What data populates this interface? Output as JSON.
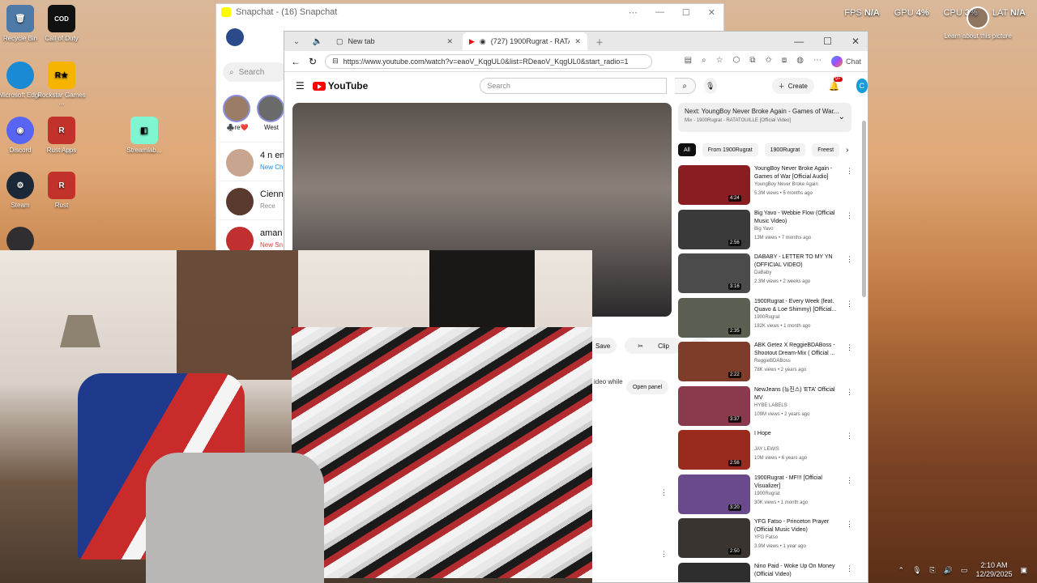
{
  "desktop": {
    "icons": [
      {
        "label": "Recycle Bin",
        "icon": "recycle-bin-icon",
        "color": "#4e7aa8"
      },
      {
        "label": "Call of Duty",
        "icon": "call-of-duty-icon",
        "color": "#111111"
      },
      {
        "label": "Microsoft Edge",
        "icon": "edge-icon",
        "color": "#1a8ad4"
      },
      {
        "label": "Rockstar Games ...",
        "icon": "rockstar-icon",
        "color": "#f4b400"
      },
      {
        "label": "Discord",
        "icon": "discord-icon",
        "color": "#5865f2"
      },
      {
        "label": "Rust Apps",
        "icon": "rust-icon",
        "color": "#c2322a"
      },
      {
        "label": "Streamlab...",
        "icon": "streamlabs-icon",
        "color": "#80f5d2"
      },
      {
        "label": "Steam",
        "icon": "steam-icon",
        "color": "#1b2838"
      },
      {
        "label": "Rust",
        "icon": "rust-icon",
        "color": "#c2322a"
      },
      {
        "label": "OBS",
        "icon": "obs-icon",
        "color": "#302e31"
      }
    ]
  },
  "overlay": {
    "fps_label": "FPS",
    "fps_value": "N/A",
    "gpu_label": "GPU",
    "gpu_value": "4%",
    "cpu_label": "CPU",
    "cpu_value": "3%",
    "lat_label": "LAT",
    "lat_value": "N/A"
  },
  "learn": {
    "text": "Learn about this picture"
  },
  "snapchat": {
    "title": "Snapchat - (16) Snapchat",
    "search_placeholder": "Search",
    "stories": [
      {
        "label": "♣️re❤️"
      },
      {
        "label": "West"
      }
    ],
    "chats": [
      {
        "name": "4 n em",
        "status": "New Ch"
      },
      {
        "name": "Cienna",
        "status": "Rece"
      },
      {
        "name": "aman",
        "status": "New Sn"
      }
    ]
  },
  "browser": {
    "tabs": [
      {
        "label": "New tab"
      },
      {
        "label": "(727) 1900Rugrat - RATATOUIL"
      }
    ],
    "url": "https://www.youtube.com/watch?v=eaoV_KqgUL0&list=RDeaoV_KqgUL0&start_radio=1",
    "chat_label": "Chat"
  },
  "youtube": {
    "logo_text": "YouTube",
    "search_placeholder": "Search",
    "create_label": "Create",
    "notif_badge": "9+",
    "avatar_letter": "C",
    "save_label": "Save",
    "clip_label": "Clip",
    "video_while": "ideo while",
    "open_panel": "Open panel",
    "next_title": "Next: YoungBoy Never Broke Again - Games of War...",
    "next_sub": "Mix - 1900Rugrat - RATATOUILLE [Official Video]",
    "chips": [
      "All",
      "From 1900Rugrat",
      "1900Rugrat",
      "Freest"
    ],
    "recommendations": [
      {
        "title": "YoungBoy Never Broke Again - Games of War [Official Audio]",
        "channel": "YoungBoy Never Broke Again",
        "meta": "5.3M views • 5 months ago",
        "duration": "4:24",
        "color": "#8a1d22"
      },
      {
        "title": "Big Yavo - Webbie Flow (Official Music Video)",
        "channel": "Big Yavo",
        "meta": "13M views • 7 months ago",
        "duration": "2:56",
        "color": "#3a3a3a"
      },
      {
        "title": "DABABY - LETTER TO MY YN (OFFICIAL VIDEO)",
        "channel": "DaBaby",
        "meta": "2.3M views • 2 weeks ago",
        "duration": "3:16",
        "color": "#4b4b4b"
      },
      {
        "title": "1900Rugrat - Every Week (feat. Quavo & Loe Shimmy) [Official...",
        "channel": "1900Rugrat",
        "meta": "182K views • 1 month ago",
        "duration": "2:35",
        "color": "#5a5f52"
      },
      {
        "title": "ABK Getez X ReggieBDABoss - Shootout Dream-Mix ( Official ...",
        "channel": "ReggieBDABoss",
        "meta": "78K views • 2 years ago",
        "duration": "2:22",
        "color": "#7e3c2a"
      },
      {
        "title": "NewJeans (뉴진스) 'ETA' Official MV",
        "channel": "HYBE LABELS",
        "meta": "109M views • 2 years ago",
        "duration": "3:37",
        "color": "#8a3a4d"
      },
      {
        "title": "I Hope",
        "channel": "JAY LEWIS",
        "meta": "10M views • 6 years ago",
        "duration": "2:56",
        "color": "#9a2a1e"
      },
      {
        "title": "1900Rugrat - MF!!! [Official Visualizer]",
        "channel": "1900Rugrat",
        "meta": "30K views • 1 month ago",
        "duration": "3:20",
        "color": "#6a4a8a"
      },
      {
        "title": "YFG Fatso - Princeton Prayer (Official Music Video)",
        "channel": "YFG Fatso",
        "meta": "3.9M views • 1 year ago",
        "duration": "2:50",
        "color": "#3a3430"
      },
      {
        "title": "Nino Paid - Woke Up On Money (Official Video)",
        "channel": "",
        "meta": "",
        "duration": "",
        "color": "#2e2e2e"
      }
    ]
  },
  "taskbar": {
    "time": "2:10 AM",
    "date": "12/29/2025"
  }
}
